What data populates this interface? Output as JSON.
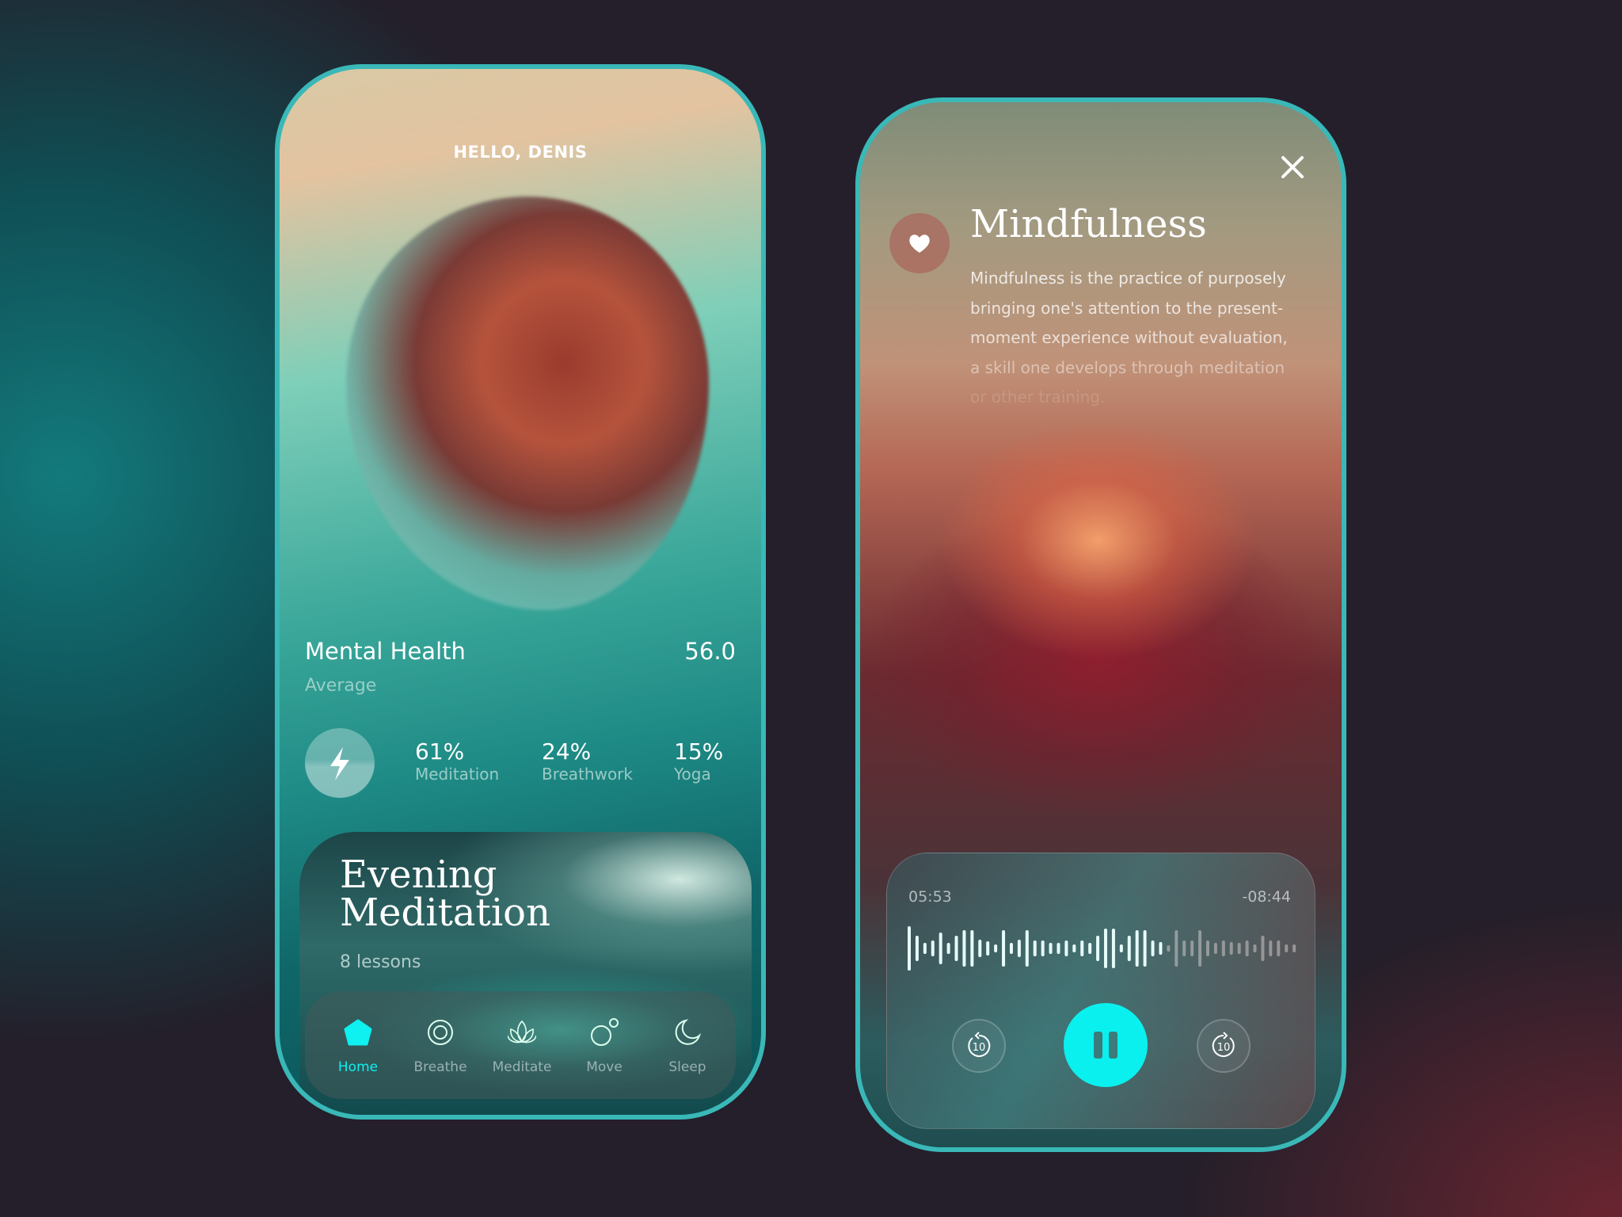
{
  "home": {
    "greeting": "HELLO, DENIS",
    "metric": {
      "title": "Mental Health",
      "value": "56.0",
      "subtitle": "Average"
    },
    "stats": [
      {
        "value": "61%",
        "label": "Meditation"
      },
      {
        "value": "24%",
        "label": "Breathwork"
      },
      {
        "value": "15%",
        "label": "Yoga"
      }
    ],
    "card": {
      "title_line1": "Evening",
      "title_line2": "Meditation",
      "subtitle": "8 lessons"
    },
    "nav": [
      {
        "label": "Home",
        "icon": "home-icon",
        "active": true
      },
      {
        "label": "Breathe",
        "icon": "breathe-icon"
      },
      {
        "label": "Meditate",
        "icon": "lotus-icon"
      },
      {
        "label": "Move",
        "icon": "move-icon"
      },
      {
        "label": "Sleep",
        "icon": "moon-icon"
      }
    ]
  },
  "player": {
    "title": "Mindfulness",
    "description": [
      "Mindfulness is the practice of purposely",
      "bringing one's attention to the present-",
      "moment experience without evaluation,",
      "a skill one develops through meditation",
      "or other training."
    ],
    "elapsed": "05:53",
    "remaining": "-08:44",
    "progress": 0.65,
    "rewind_label": "10",
    "forward_label": "10"
  },
  "colors": {
    "accent": "#0ff0f0",
    "frame": "#3ab8b8"
  }
}
